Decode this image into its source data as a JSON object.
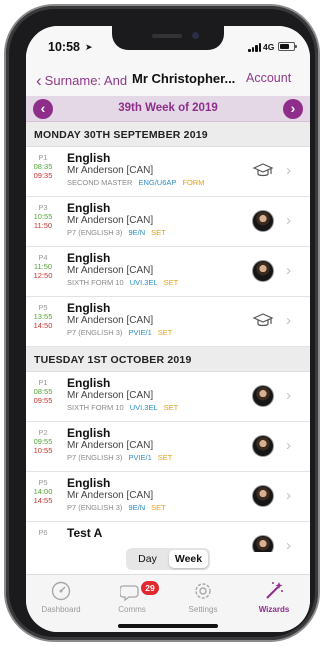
{
  "status_bar": {
    "time": "10:58",
    "network": "4G"
  },
  "nav": {
    "back_label": "Surname: And",
    "title": "Mr Christopher...",
    "account_label": "Account"
  },
  "week": {
    "title": "39th Week of 2019"
  },
  "days": [
    {
      "header": "MONDAY 30TH SEPTEMBER 2019",
      "lessons": [
        {
          "period": "P1",
          "start": "08:35",
          "end": "09:35",
          "subject": "English",
          "teacher": "Mr Anderson [CAN]",
          "room": "SECOND MASTER",
          "group": "ENG/U6AP",
          "type": "FORM",
          "icon": "graduation-cap-icon"
        },
        {
          "period": "P3",
          "start": "10:55",
          "end": "11:50",
          "subject": "English",
          "teacher": "Mr Anderson [CAN]",
          "room": "P7 (ENGLISH 3)",
          "group": "9E/N",
          "type": "SET",
          "icon": "teacher-avatar"
        },
        {
          "period": "P4",
          "start": "11:50",
          "end": "12:50",
          "subject": "English",
          "teacher": "Mr Anderson [CAN]",
          "room": "SIXTH FORM 10",
          "group": "UVI.3EL",
          "type": "SET",
          "icon": "teacher-avatar"
        },
        {
          "period": "P5",
          "start": "13:55",
          "end": "14:50",
          "subject": "English",
          "teacher": "Mr Anderson [CAN]",
          "room": "P7 (ENGLISH 3)",
          "group": "PVIE/1",
          "type": "SET",
          "icon": "graduation-cap-icon"
        }
      ]
    },
    {
      "header": "TUESDAY 1ST OCTOBER 2019",
      "lessons": [
        {
          "period": "P1",
          "start": "08:55",
          "end": "09:55",
          "subject": "English",
          "teacher": "Mr Anderson [CAN]",
          "room": "SIXTH FORM 10",
          "group": "UVI.3EL",
          "type": "SET",
          "icon": "teacher-avatar"
        },
        {
          "period": "P2",
          "start": "09:55",
          "end": "10:55",
          "subject": "English",
          "teacher": "Mr Anderson [CAN]",
          "room": "P7 (ENGLISH 3)",
          "group": "PVIE/1",
          "type": "SET",
          "icon": "teacher-avatar"
        },
        {
          "period": "P5",
          "start": "14:00",
          "end": "14:55",
          "subject": "English",
          "teacher": "Mr Anderson [CAN]",
          "room": "P7 (ENGLISH 3)",
          "group": "9E/N",
          "type": "SET",
          "icon": "teacher-avatar"
        },
        {
          "period": "P6",
          "start": "",
          "end": "",
          "subject": "Test A",
          "teacher": "",
          "room": "",
          "group": "",
          "type": "",
          "icon": "teacher-avatar"
        }
      ]
    }
  ],
  "view_toggle": {
    "day_label": "Day",
    "week_label": "Week",
    "selected": "Week"
  },
  "tabs": [
    {
      "label": "Dashboard",
      "icon": "gauge-icon",
      "active": false
    },
    {
      "label": "Comms",
      "icon": "chat-bubbles-icon",
      "badge": "29",
      "active": false
    },
    {
      "label": "Settings",
      "icon": "gear-icon",
      "active": false
    },
    {
      "label": "Wizards",
      "icon": "magic-wand-icon",
      "active": true
    }
  ],
  "colors": {
    "accent": "#8e2e8a",
    "start_time": "#55a33a",
    "end_time": "#c8352f",
    "group": "#2c8ec9",
    "type": "#e2a11a",
    "badge": "#e0282e"
  }
}
